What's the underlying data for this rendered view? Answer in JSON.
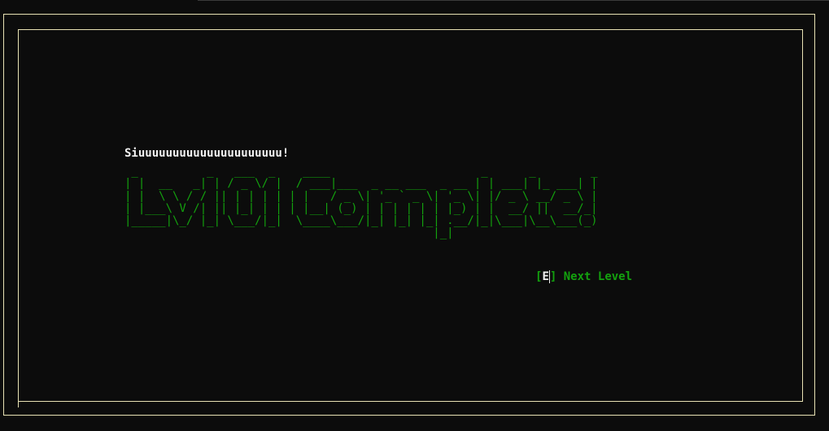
{
  "screen": {
    "message": "Siuuuuuuuuuuuuuuuuuuuuu!",
    "banner_ascii": " _          _   ___  _    ____                      _      _        _\n| |  __   _| | / _ \\/ |  / ___|___  _ __ ___  _ __ | | ___| |_ ___| |\n| |  \\ \\ / / || | | | | | |   / _ \\| '_ ` _ \\| '_ \\| |/ _ \\ __/ _ \\ |\n| |___\\ V /| || |_| | | | |__| (_) | | | | | | |_) | |  __/ ||  __/_|\n|_____|\\_/ |_| \\___/|_|  \\____\\___/|_| |_| |_| .__/|_|\\___|\\__\\___(_)\n                                             |_|",
    "prompt": {
      "open_bracket": "[",
      "key": "E",
      "close_bracket": "]",
      "label": "Next Level"
    }
  },
  "colors": {
    "background": "#0c0c0c",
    "border": "#e8e2b4",
    "banner": "#13a10e",
    "text": "#f2f2f2"
  }
}
